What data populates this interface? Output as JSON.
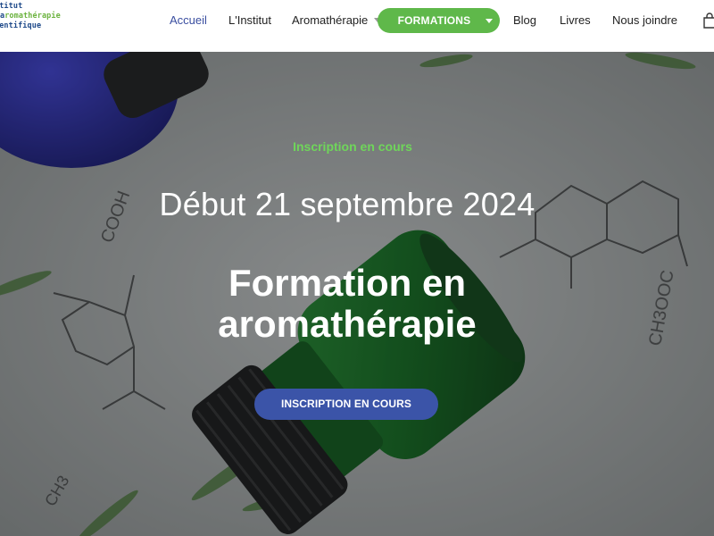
{
  "logo": {
    "line1": "stitut",
    "line2_prefix": "a",
    "line2_highlight": "romathérapie",
    "line3": "ientifique"
  },
  "nav": {
    "items": [
      {
        "label": "Accueil",
        "active": true
      },
      {
        "label": "L'Institut"
      },
      {
        "label": "Aromathérapie",
        "has_dropdown": true
      },
      {
        "label": "FORMATIONS",
        "highlighted": true,
        "has_dropdown": true
      },
      {
        "label": "Blog"
      },
      {
        "label": "Livres"
      },
      {
        "label": "Nous joindre"
      }
    ],
    "cart_icon": "shopping-bag-icon"
  },
  "hero": {
    "kicker": "Inscription en cours",
    "date_line": "Début 21 septembre 2024",
    "title_line1": "Formation en",
    "title_line2": "aromathérapie",
    "cta_label": "INSCRIPTION EN COURS"
  },
  "colors": {
    "brand_blue": "#3b54a8",
    "brand_green": "#5fb84a",
    "kicker_green": "#6fd65a",
    "nav_active": "#3a4ea0"
  }
}
